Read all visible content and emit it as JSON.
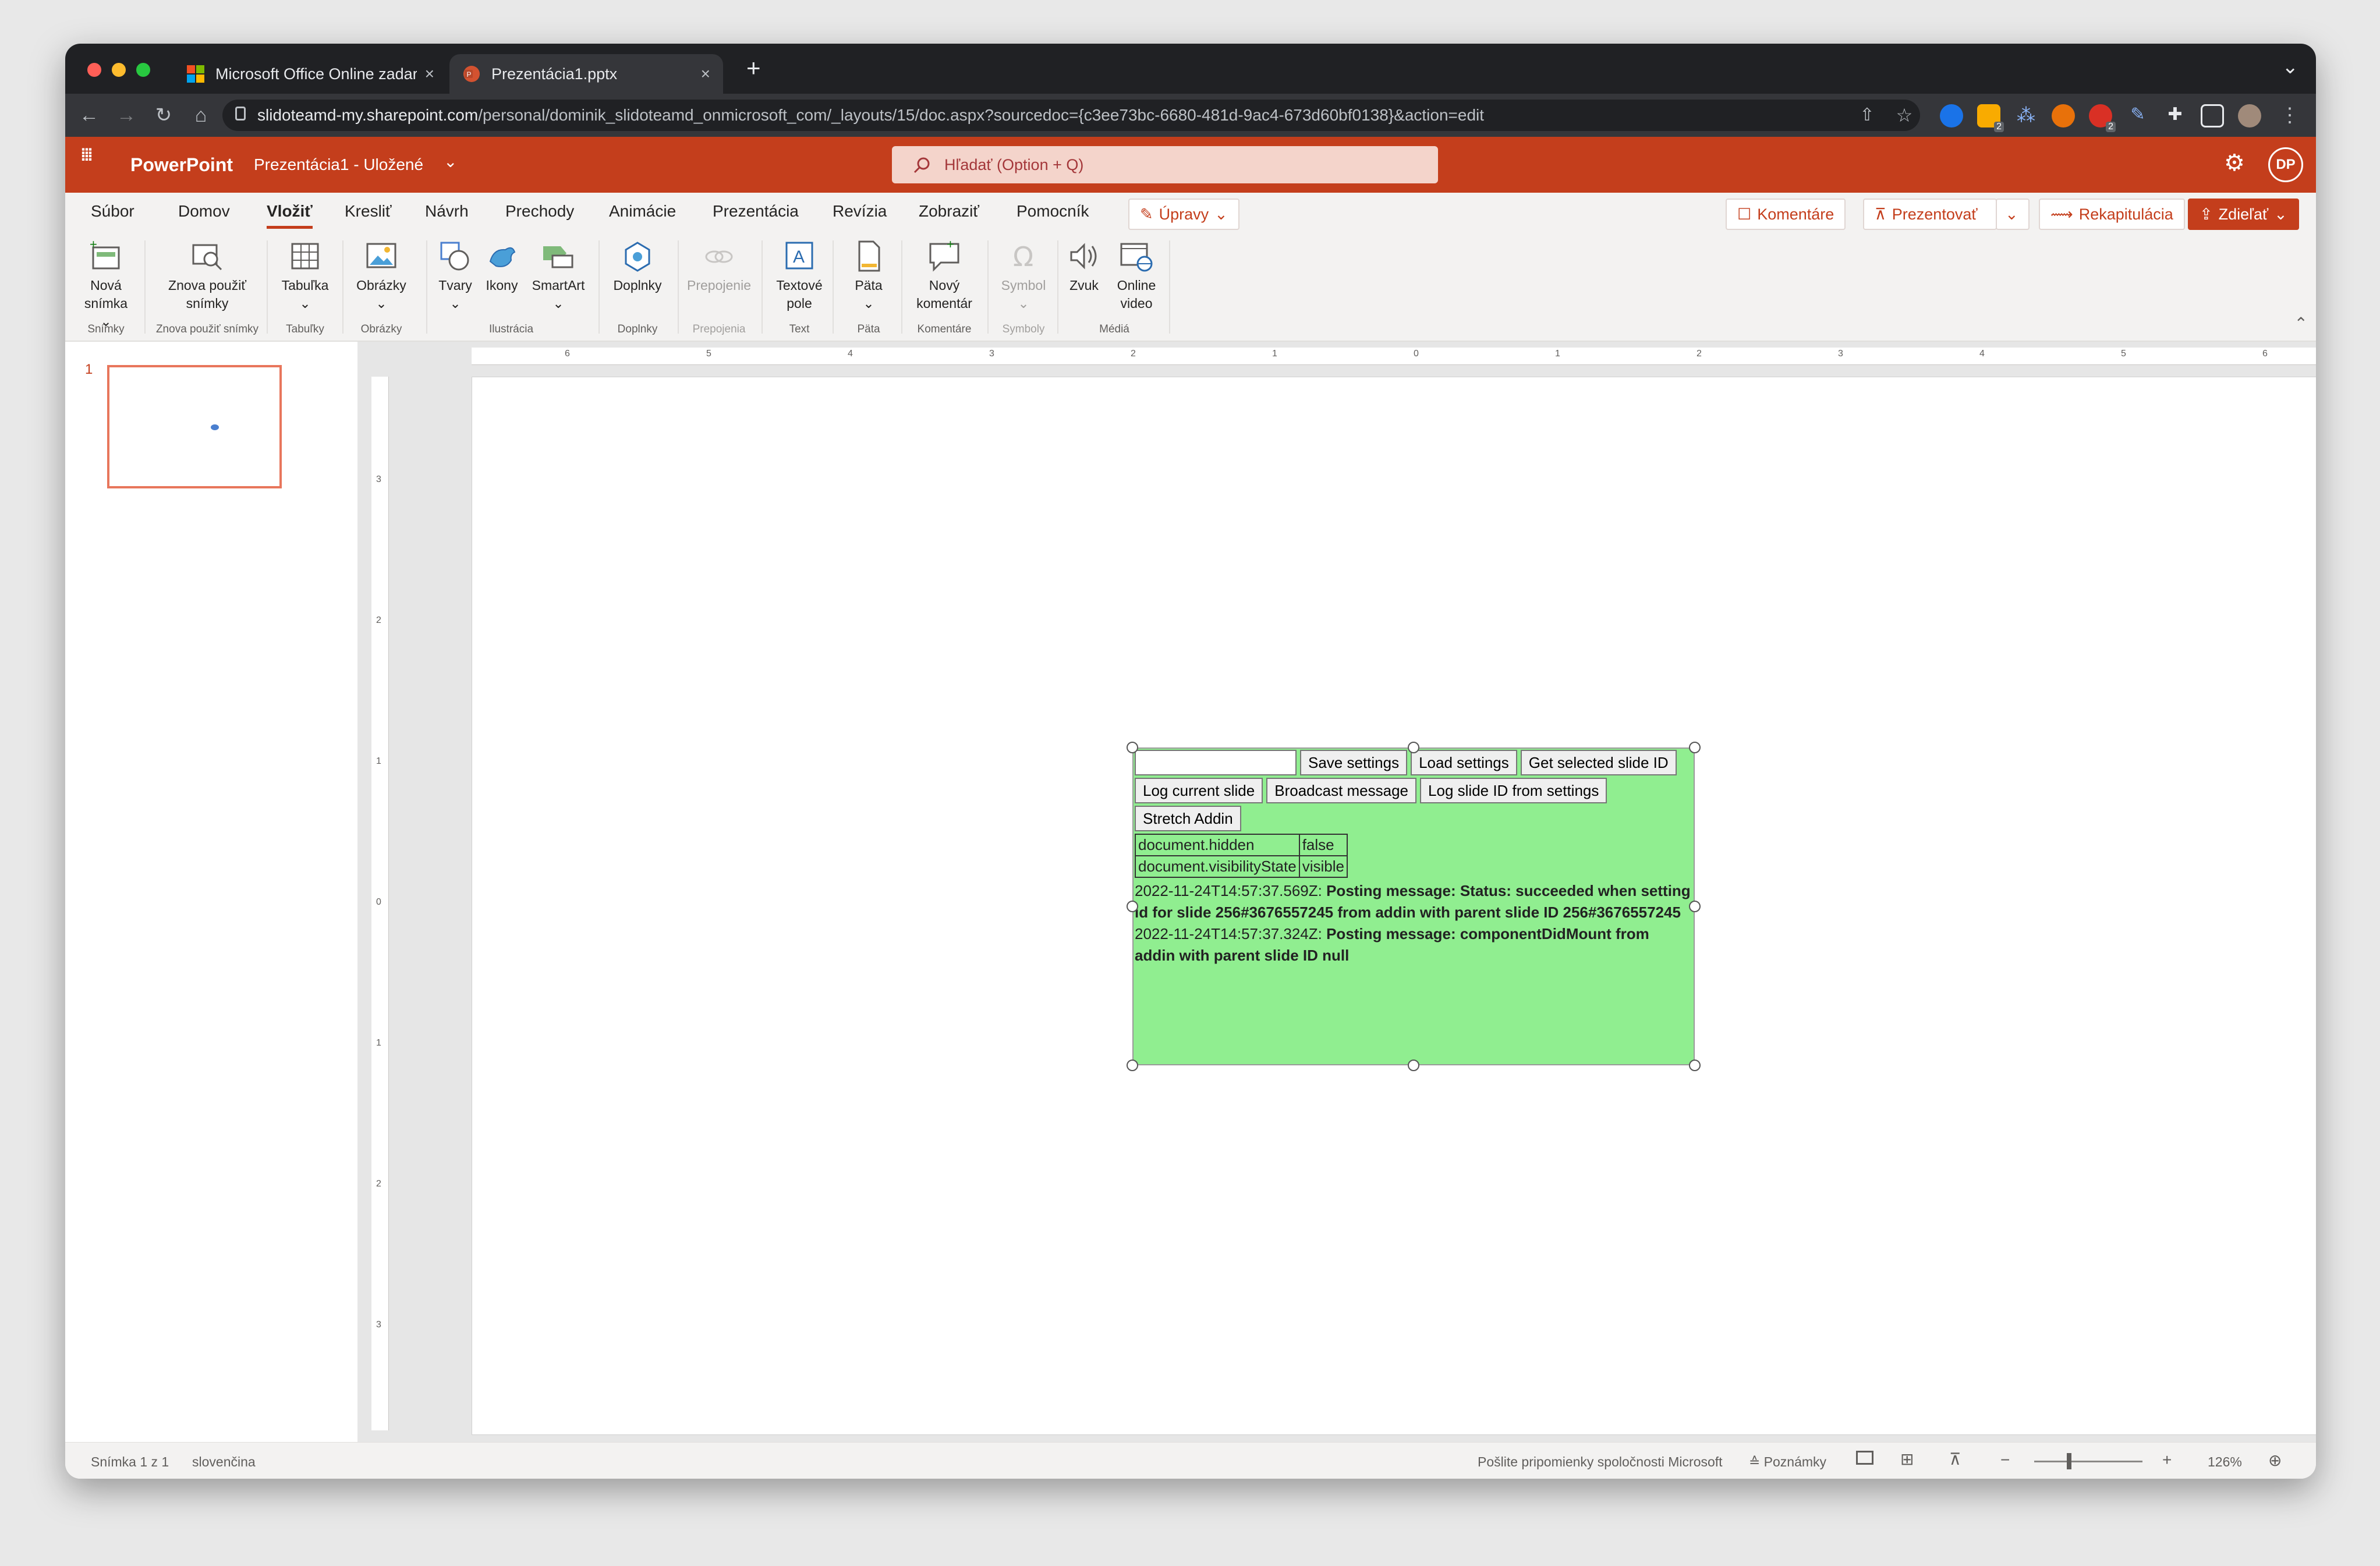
{
  "browser": {
    "tabs": [
      {
        "label": "Microsoft Office Online zadarm",
        "close": "×"
      },
      {
        "label": "Prezentácia1.pptx",
        "close": "×"
      }
    ],
    "new_tab": "+",
    "overflow": "⌄",
    "url_host": "slidoteamd-my.sharepoint.com",
    "url_path": "/personal/dominik_slidoteamd_onmicrosoft_com/_layouts/15/doc.aspx?sourcedoc={c3ee73bc-6680-481d-9ac4-673d60bf0138}&action=edit",
    "back": "←",
    "forward": "→",
    "reload": "↻",
    "home": "⌂",
    "badge_1": "2",
    "badge_2": "2",
    "menu": "⋮"
  },
  "app": {
    "launcher": "⋮⋮⋮",
    "name": "PowerPoint",
    "doc_title": "Prezentácia1 - Uložené",
    "title_chevron": "⌄",
    "search_placeholder": "Hľadať (Option + Q)",
    "avatar": "DP"
  },
  "menu": {
    "items": [
      "Súbor",
      "Domov",
      "Vložiť",
      "Kresliť",
      "Návrh",
      "Prechody",
      "Animácie",
      "Prezentácia",
      "Revízia",
      "Zobraziť",
      "Pomocník"
    ],
    "edit_mode": "Úpravy",
    "comments": "Komentáre",
    "present": "Prezentovať",
    "recap": "Rekapitulácia",
    "share": "Zdieľať"
  },
  "ribbon": {
    "buttons": [
      {
        "line1": "Nová",
        "line2": "snímka ⌄"
      },
      {
        "line1": "Znova použiť",
        "line2": "snímky"
      },
      {
        "line1": "Tabuľka",
        "line2": "⌄"
      },
      {
        "line1": "Obrázky",
        "line2": "⌄"
      },
      {
        "line1": "Tvary",
        "line2": "⌄"
      },
      {
        "line1": "Ikony",
        "line2": ""
      },
      {
        "line1": "SmartArt",
        "line2": "⌄"
      },
      {
        "line1": "Doplnky",
        "line2": ""
      },
      {
        "line1": "Prepojenie",
        "line2": ""
      },
      {
        "line1": "Textové",
        "line2": "pole"
      },
      {
        "line1": "Päta",
        "line2": "⌄"
      },
      {
        "line1": "Nový",
        "line2": "komentár"
      },
      {
        "line1": "Symbol",
        "line2": "⌄"
      },
      {
        "line1": "Zvuk",
        "line2": ""
      },
      {
        "line1": "Online",
        "line2": "video"
      }
    ],
    "groups": [
      "Snímky",
      "Znova použiť snímky",
      "Tabuľky",
      "Obrázky",
      "Ilustrácia",
      "Doplnky",
      "Prepojenia",
      "Text",
      "Päta",
      "Komentáre",
      "Symboly",
      "Médiá"
    ],
    "collapse": "⌃"
  },
  "thumbnails": {
    "number": "1"
  },
  "ruler": {
    "h_labels": [
      "6",
      "5",
      "4",
      "3",
      "2",
      "1",
      "0",
      "1",
      "2",
      "3",
      "4",
      "5",
      "6"
    ],
    "v_labels": [
      "3",
      "2",
      "1",
      "0",
      "1",
      "2",
      "3"
    ]
  },
  "addin": {
    "buttons_row1": [
      "Save settings",
      "Load settings",
      "Get selected slide ID"
    ],
    "buttons_row2": [
      "Log current slide",
      "Broadcast message",
      "Log slide ID from settings"
    ],
    "buttons_row3": [
      "Stretch Addin"
    ],
    "table": [
      {
        "key": "document.hidden",
        "value": "false"
      },
      {
        "key": "document.visibilityState",
        "value": "visible"
      }
    ],
    "log": [
      {
        "time": "2022-11-24T14:57:37.569Z: ",
        "message": "Posting message: Status: succeeded when setting id for slide 256#3676557245 from addin with parent slide ID 256#3676557245"
      },
      {
        "time": "2022-11-24T14:57:37.324Z: ",
        "message": "Posting message: componentDidMount from addin with parent slide ID null"
      }
    ],
    "background": "#90ee90"
  },
  "status": {
    "slide": "Snímka 1 z 1",
    "language": "slovenčina",
    "feedback": "Pošlite pripomienky spoločnosti Microsoft",
    "notes": "Poznámky",
    "zoom_out": "−",
    "zoom_in": "+",
    "zoom": "126%",
    "fit": "⊕"
  },
  "colors": {
    "brand": "#c43e1c",
    "search_bg": "#f4d4cb",
    "thumb_border": "#e8765c"
  }
}
